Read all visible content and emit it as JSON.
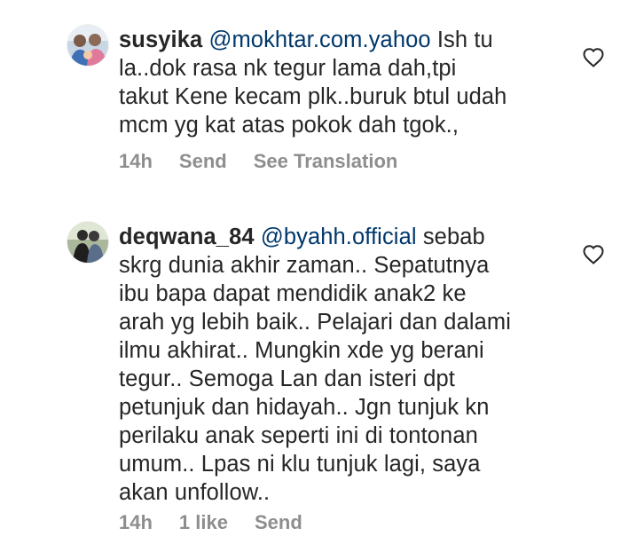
{
  "comments": [
    {
      "username": "susyika",
      "mention": "@mokhtar.com.yahoo",
      "lines": [
        "Ish tu",
        "la..dok rasa nk tegur lama dah,tpi",
        "takut Kene kecam plk..buruk btul udah",
        "mcm yg kat atas pokok dah tgok.,"
      ],
      "time": "14h",
      "actions": [
        "Send",
        "See Translation"
      ],
      "icon": "heart-outline-icon"
    },
    {
      "username": "deqwana_84",
      "mention": "@byahh.official",
      "lines": [
        "sebab",
        "skrg dunia akhir zaman.. Sepatutnya",
        "ibu bapa dapat mendidik anak2 ke",
        "arah yg lebih baik.. Pelajari dan dalami",
        "ilmu akhirat.. Mungkin xde yg berani",
        "tegur.. Semoga Lan dan isteri dpt",
        "petunjuk dan hidayah.. Jgn tunjuk kn",
        "perilaku anak seperti ini di tontonan",
        "umum.. Lpas ni klu tunjuk lagi, saya",
        "akan unfollow.."
      ],
      "time": "14h",
      "likes": "1 like",
      "actions": [
        "Send"
      ],
      "icon": "heart-outline-icon"
    }
  ],
  "colors": {
    "text": "#262626",
    "mention": "#00376b",
    "meta": "#8e8e8e"
  }
}
